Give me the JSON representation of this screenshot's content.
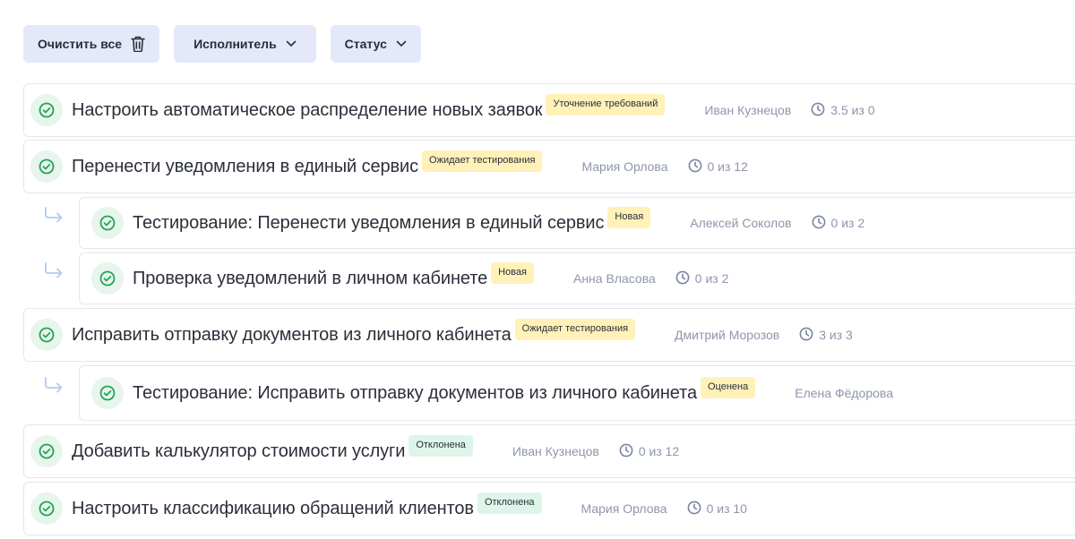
{
  "toolbar": {
    "clear_label": "Очистить все",
    "assignee_label": "Исполнитель",
    "status_label": "Статус"
  },
  "colors": {
    "accent_bg": "#e4e8f9",
    "badge_yellow": "#fff1b8",
    "badge_green": "#def5ea",
    "check_green": "#25a35a"
  },
  "tasks": [
    {
      "title": "Настроить автоматическое распределение новых заявок",
      "status": "Уточнение требований",
      "assignee": "Иван Кузнецов",
      "time": "3.5 из 0"
    },
    {
      "title": "Перенести уведомления в единый сервис",
      "status": "Ожидает тестирования",
      "assignee": "Мария Орлова",
      "time": "0 из 12"
    },
    {
      "title": "Тестирование: Перенести уведомления в единый сервис",
      "status": "Новая",
      "assignee": "Алексей Соколов",
      "time": "0 из 2"
    },
    {
      "title": "Проверка уведомлений в личном кабинете",
      "status": "Новая",
      "assignee": "Анна Власова",
      "time": "0 из 2"
    },
    {
      "title": "Исправить отправку документов из личного кабинета",
      "status": "Ожидает тестирования",
      "assignee": "Дмитрий Морозов",
      "time": "3 из 3"
    },
    {
      "title": "Тестирование: Исправить отправку документов из личного кабинета",
      "status": "Оценена",
      "assignee": "Елена Фёдорова"
    },
    {
      "title": "Добавить калькулятор стоимости услуги",
      "status": "Отклонена",
      "assignee": "Иван Кузнецов",
      "time": "0 из 12"
    },
    {
      "title": "Настроить классификацию обращений клиентов",
      "status": "Отклонена",
      "assignee": "Мария Орлова",
      "time": "0 из 10"
    }
  ]
}
